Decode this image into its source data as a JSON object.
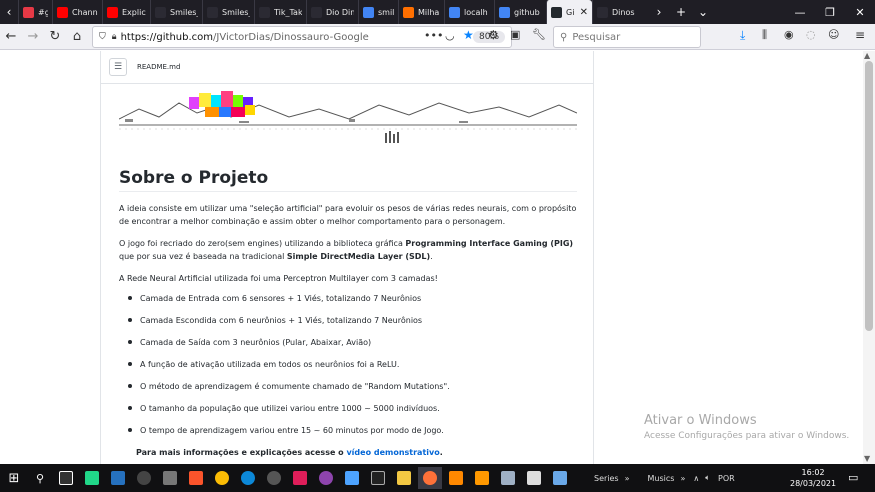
{
  "tabs": [
    {
      "label": "#geral",
      "color": "#e63946"
    },
    {
      "label": "Chann",
      "color": "#ff0000"
    },
    {
      "label": "Explic",
      "color": "#ff0000"
    },
    {
      "label": "Smiles_Jog",
      "color": "#2b2a33"
    },
    {
      "label": "Smiles_Jog",
      "color": "#2b2a33"
    },
    {
      "label": "Tik_Tak_To",
      "color": "#2b2a33"
    },
    {
      "label": "Dio Dino C",
      "color": "#2b2a33"
    },
    {
      "label": "smiles",
      "color": "#4285f4"
    },
    {
      "label": "Milha",
      "color": "#ff6f00"
    },
    {
      "label": "localh",
      "color": "#4285f4"
    },
    {
      "label": "github",
      "color": "#4285f4"
    },
    {
      "label": "Git",
      "color": "#24292e",
      "active": true
    },
    {
      "label": "Dinos",
      "color": "#2b2a33"
    }
  ],
  "nav": {
    "url_host": "https://github.com",
    "url_path": "/JVictorDias/Dinossauro-Google",
    "zoom": "80%",
    "search_placeholder": "Pesquisar"
  },
  "readme": {
    "filename": "README.md",
    "heading": "Sobre o Projeto",
    "p1": "A ideia consiste em utilizar uma \"seleção artificial\" para evoluir os pesos de várias redes neurais, com o propósito de encontrar a melhor combinação e assim obter o melhor comportamento para o personagem.",
    "p2_a": "O jogo foi recriado do zero(sem engines) utilizando a biblioteca gráfica ",
    "p2_b": "Programming Interface Gaming (PIG)",
    "p2_c": " que por sua vez é baseada na tradicional ",
    "p2_d": "Simple DirectMedia Layer (SDL)",
    "p2_e": ".",
    "p3": "A Rede Neural Artificial utilizada foi uma Perceptron Multilayer com 3 camadas!",
    "bullets": [
      "Camada de Entrada com 6 sensores + 1 Viés, totalizando 7 Neurônios",
      "Camada Escondida com 6 neurônios + 1 Viés, totalizando 7 Neurônios",
      "Camada de Saída com 3 neurônios (Pular, Abaixar, Avião)",
      "A função de ativação utilizada em todos os neurônios foi a ReLU.",
      "O método de aprendizagem é comumente chamado de \"Random Mutations\".",
      "O tamanho da população que utilizei variou entre 1000 ~ 5000 indivíduos.",
      "O tempo de aprendizagem variou entre 15 ~ 60 minutos por modo de Jogo."
    ],
    "final_text": "Para mais informações e explicações acesse o ",
    "final_link": "vídeo demonstrativo",
    "final_end": "."
  },
  "watermark": {
    "line1": "Ativar o Windows",
    "line2": "Acesse Configurações para ativar o Windows."
  },
  "taskbar": {
    "series_label": "Series",
    "musics_label": "Musics",
    "lang": "POR",
    "time": "16:02",
    "date": "28/03/2021"
  }
}
